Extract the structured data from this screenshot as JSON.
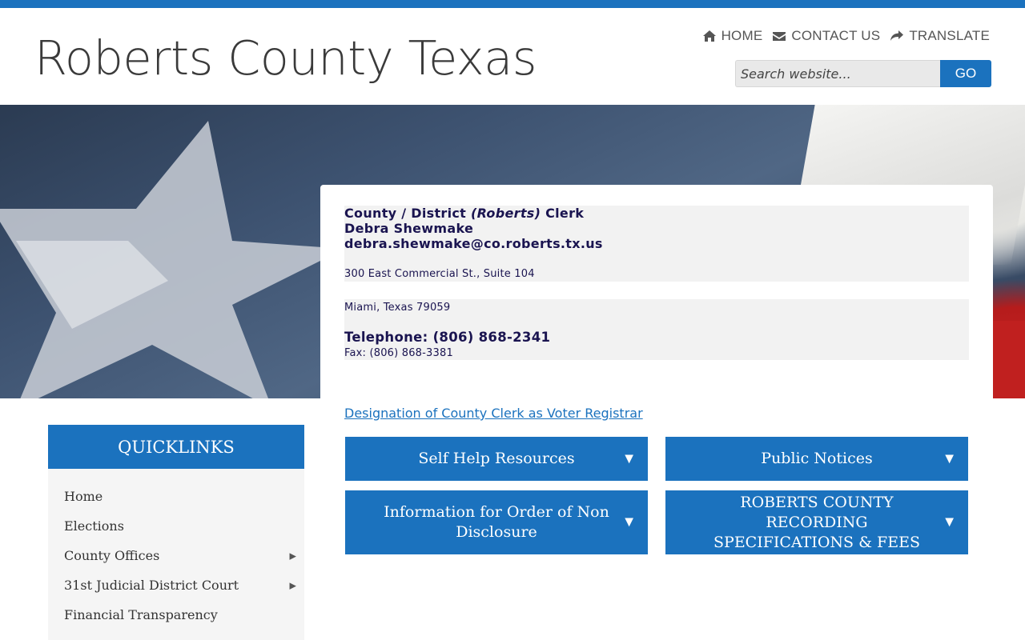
{
  "site": {
    "title": "Roberts County Texas"
  },
  "topnav": {
    "items": [
      {
        "label": "HOME",
        "icon": "home-icon"
      },
      {
        "label": "CONTACT US",
        "icon": "envelope-icon"
      },
      {
        "label": "TRANSLATE",
        "icon": "share-arrow-icon"
      }
    ]
  },
  "search": {
    "placeholder": "Search website...",
    "button_label": "GO"
  },
  "clerk": {
    "title_prefix": "County / District ",
    "title_county": "(Roberts)",
    "title_suffix": " Clerk",
    "name": "Debra Shewmake",
    "email": "debra.shewmake@co.roberts.tx.us",
    "address_line1": "300 East Commercial St., Suite 104",
    "address_line2": "Miami, Texas 79059",
    "telephone": "Telephone: (806) 868-2341",
    "fax": "Fax:  (806) 868-3381"
  },
  "designation_link": "Designation of County Clerk as Voter Registrar",
  "accordions": [
    {
      "label": "Self Help Resources",
      "arrow": "▼"
    },
    {
      "label": "Public Notices",
      "arrow": "▼"
    },
    {
      "label": "Information for Order of Non Disclosure",
      "arrow": "▼"
    },
    {
      "label": "ROBERTS COUNTY RECORDING SPECIFICATIONS & FEES",
      "arrow": "▼"
    }
  ],
  "quicklinks": {
    "heading": "QUICKLINKS",
    "items": [
      {
        "label": "Home",
        "caret": ""
      },
      {
        "label": "Elections",
        "caret": ""
      },
      {
        "label": "County Offices",
        "caret": "▶"
      },
      {
        "label": "31st Judicial District Court",
        "caret": "▶"
      },
      {
        "label": "Financial Transparency",
        "caret": ""
      }
    ]
  },
  "colors": {
    "brand_blue": "#1b72be",
    "clerk_text": "#1a1450"
  }
}
